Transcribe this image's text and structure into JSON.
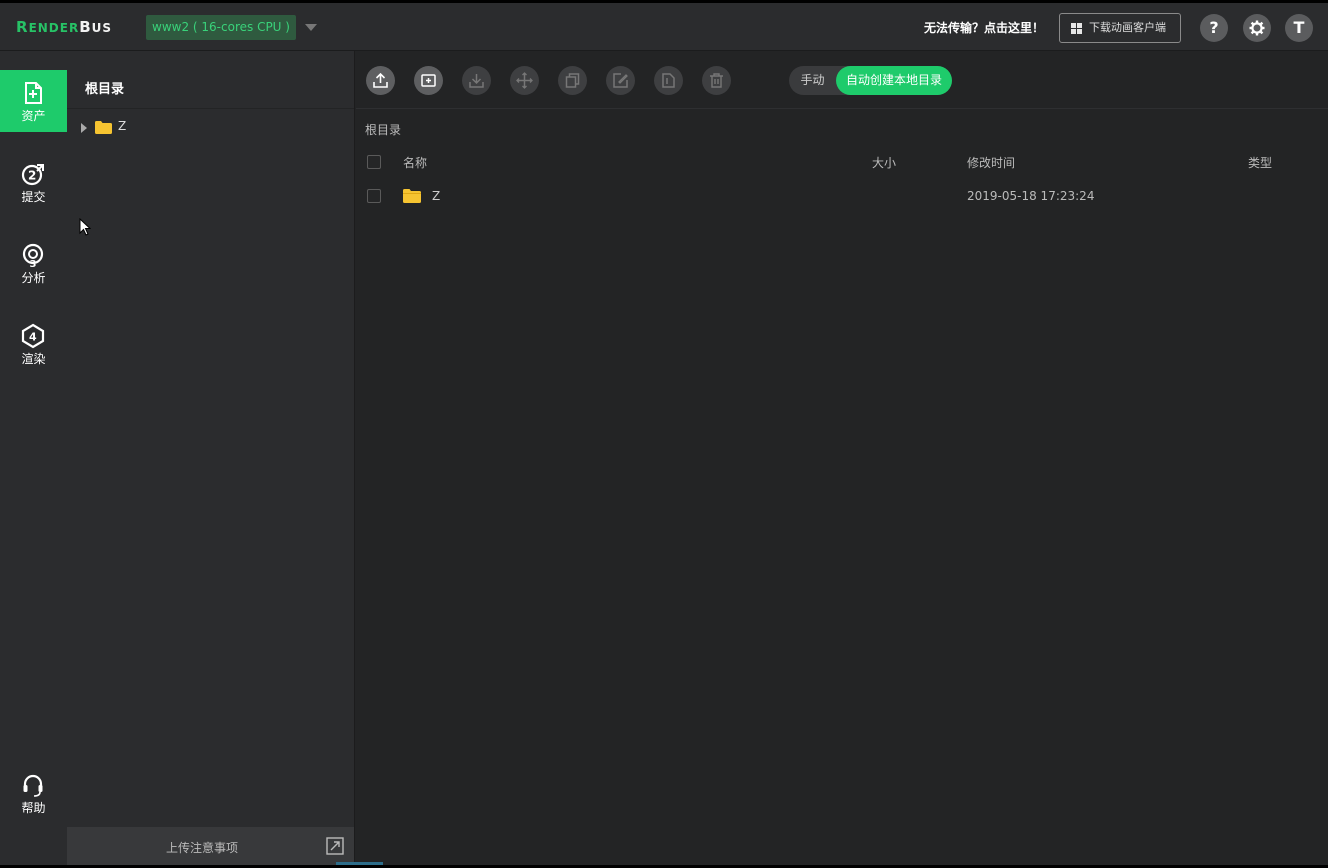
{
  "header": {
    "logo": {
      "part1": "R",
      "part2": "ENDER",
      "part3": "B",
      "part4": "US"
    },
    "server_select": "www2 ( 16-cores CPU )",
    "trouble_link": "无法传输？点击这里！",
    "download_client": "下载动画客户端",
    "help_label": "?",
    "user_initial": "T"
  },
  "nav": {
    "items": [
      {
        "label": "资产",
        "active": true,
        "icon": "assets-icon"
      },
      {
        "label": "提交",
        "active": false,
        "icon": "submit-icon"
      },
      {
        "label": "分析",
        "active": false,
        "icon": "analyze-icon"
      },
      {
        "label": "渲染",
        "active": false,
        "icon": "render-icon"
      }
    ],
    "help": {
      "label": "帮助",
      "icon": "headset-icon"
    }
  },
  "tree": {
    "title": "根目录",
    "items": [
      {
        "label": "Z",
        "icon": "folder-icon"
      }
    ],
    "footer_notice": "上传注意事项"
  },
  "toolbar": {
    "buttons": [
      "upload-icon",
      "new-folder-icon",
      "download-icon",
      "move-icon",
      "copy-icon",
      "rename-icon",
      "paste-icon",
      "delete-icon"
    ],
    "mode_manual": "手动",
    "mode_auto": "自动创建本地目录"
  },
  "main": {
    "breadcrumb": "根目录",
    "columns": {
      "name": "名称",
      "size": "大小",
      "modified": "修改时间",
      "type": "类型"
    },
    "rows": [
      {
        "name": "Z",
        "size": "",
        "modified": "2019-05-18 17:23:24",
        "type": ""
      }
    ]
  },
  "colors": {
    "accent": "#1ecb6b",
    "folder": "#f6c431",
    "background": "#232425",
    "panel": "#2b2c2e"
  }
}
